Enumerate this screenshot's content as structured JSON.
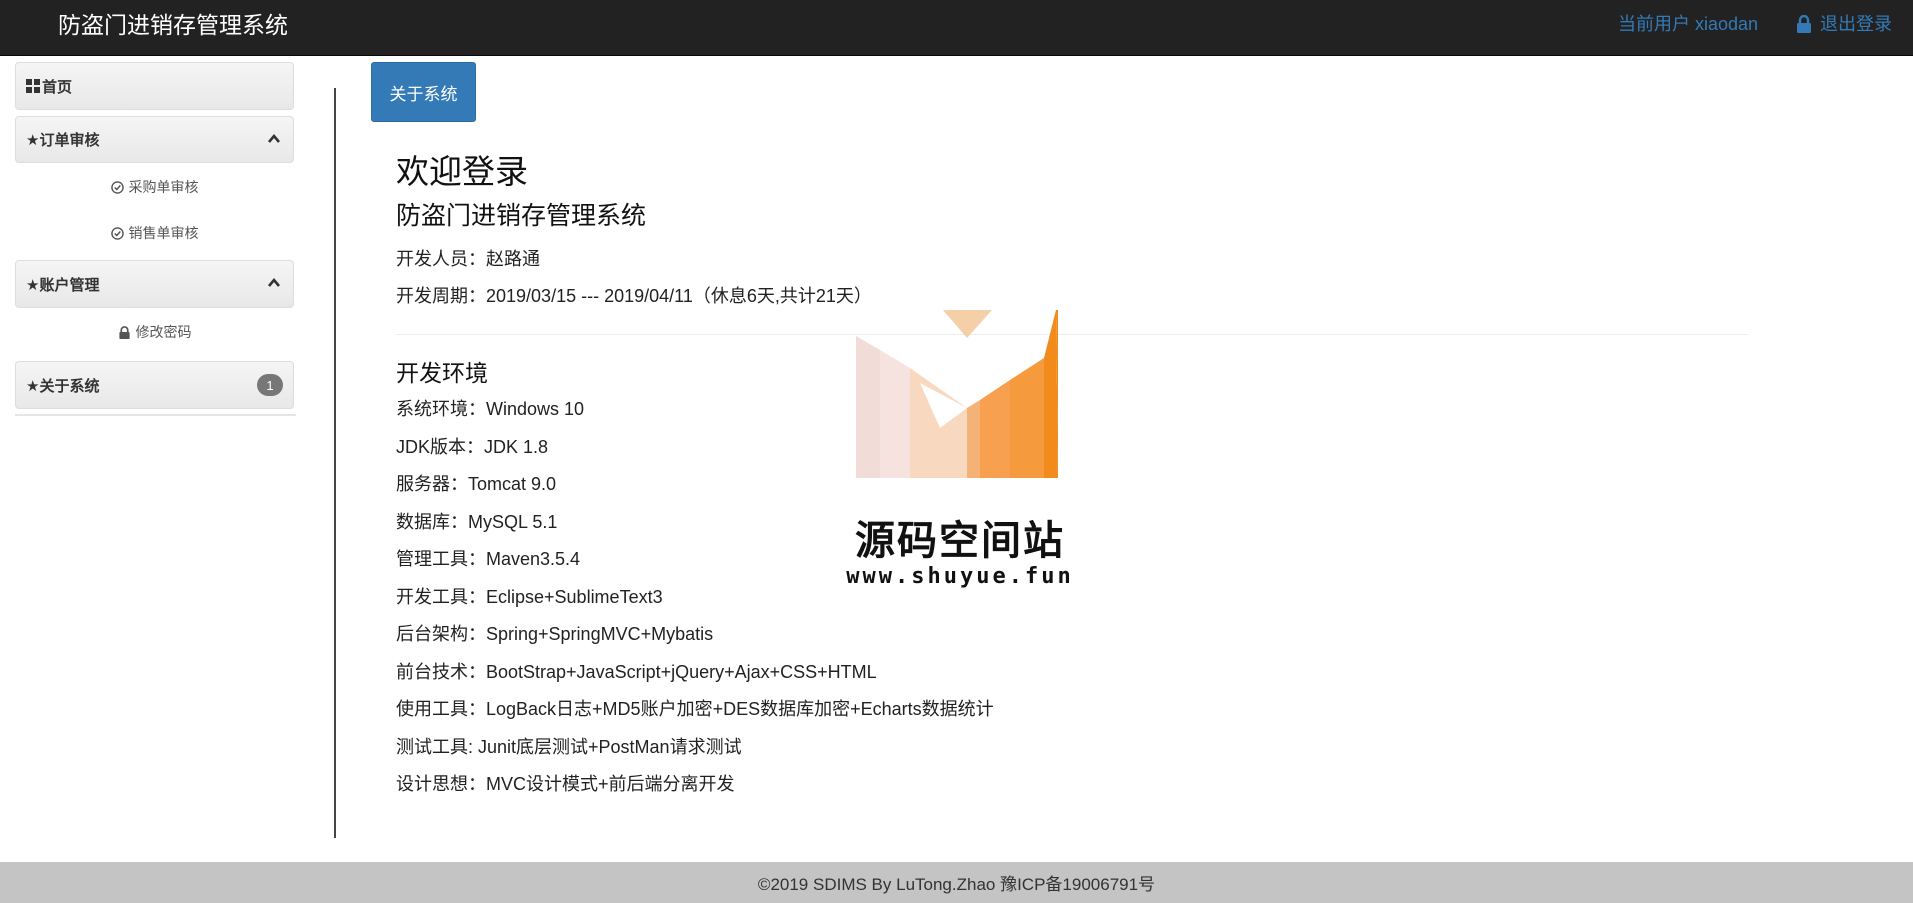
{
  "header": {
    "brand": "防盗门进销存管理系统",
    "current_user": "当前用户 xiaodan",
    "logout": "退出登录"
  },
  "sidebar": {
    "home": "首页",
    "order_review": "★订单审核",
    "purchase_review": "采购单审核",
    "sales_review": "销售单审核",
    "account_mgmt": "★账户管理",
    "change_password": "修改密码",
    "about": "★关于系统",
    "about_badge": "1"
  },
  "main": {
    "tab_button": "关于系统",
    "welcome": "欢迎登录",
    "system_name": "防盗门进销存管理系统",
    "developer": "开发人员：赵路通",
    "period": "开发周期：2019/03/15 --- 2019/04/11（休息6天,共计21天）",
    "env_title": "开发环境",
    "env_items": [
      "系统环境：Windows 10",
      "JDK版本：JDK 1.8",
      "服务器：Tomcat 9.0",
      "数据库：MySQL 5.1",
      "管理工具：Maven3.5.4",
      "开发工具：Eclipse+SublimeText3",
      "后台架构：Spring+SpringMVC+Mybatis",
      "前台技术：BootStrap+JavaScript+jQuery+Ajax+CSS+HTML",
      "使用工具：LogBack日志+MD5账户加密+DES数据库加密+Echarts数据统计",
      "测试工具: Junit底层测试+PostMan请求测试",
      "设计思想：MVC设计模式+前后端分离开发"
    ]
  },
  "watermark": {
    "title": "源码空间站",
    "url": "www.shuyue.fun"
  },
  "footer": {
    "text": "©2019 SDIMS By LuTong.Zhao 豫ICP备19006791号"
  },
  "colors": {
    "navbar_bg": "#222222",
    "link": "#337ab7",
    "primary_button": "#337ab7",
    "footer_bg": "#c4c4c4",
    "badge": "#777777"
  }
}
